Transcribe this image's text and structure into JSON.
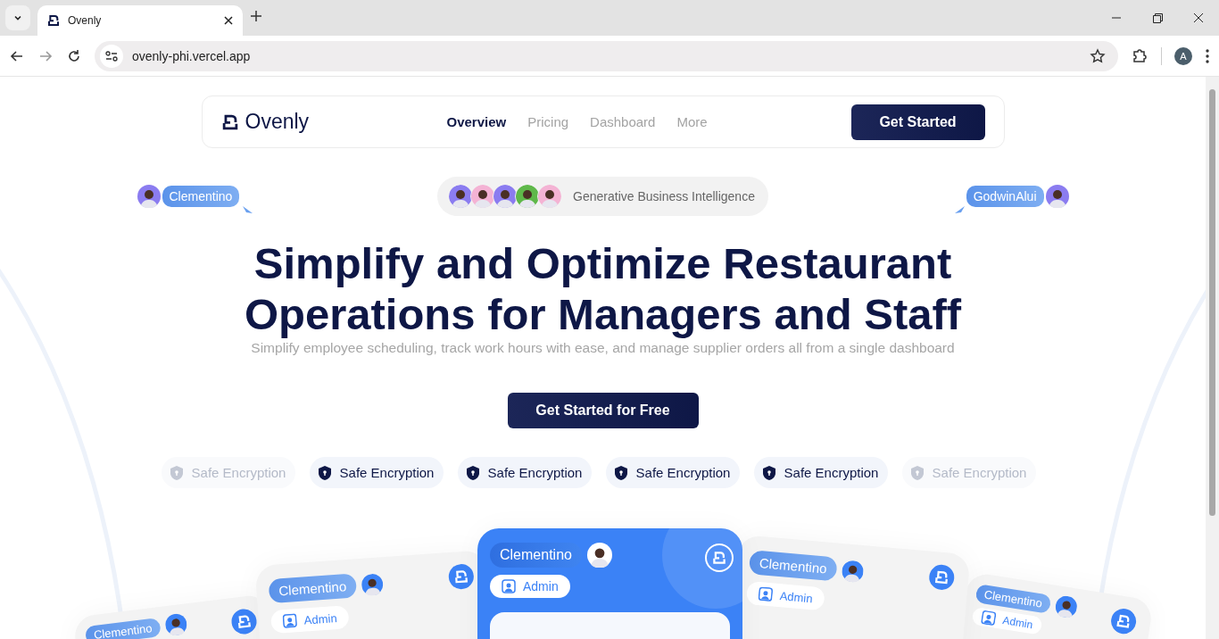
{
  "browser": {
    "tabs": [
      {
        "title": "Ovenly",
        "selected": true
      }
    ],
    "url": "ovenly-phi.vercel.app",
    "profile_initial": "A"
  },
  "nav": {
    "brand": "Ovenly",
    "links": [
      {
        "label": "Overview",
        "selected": true
      },
      {
        "label": "Pricing",
        "selected": false
      },
      {
        "label": "Dashboard",
        "selected": false
      },
      {
        "label": "More",
        "selected": false
      }
    ],
    "cta": "Get Started"
  },
  "hero": {
    "left_tag": {
      "name": "Clementino"
    },
    "right_tag": {
      "name": "GodwinAlui"
    },
    "badge": {
      "avatars": [
        {
          "color": "#8b7cf0"
        },
        {
          "color": "#f4b3d4"
        },
        {
          "color": "#8b7cf0"
        },
        {
          "color": "#5fb84a"
        },
        {
          "color": "#f4b3d4"
        }
      ],
      "text": "Generative Business Intelligence"
    },
    "title": "Simplify and Optimize Restaurant Operations for Managers and Staff",
    "subtitle": "Simplify employee scheduling, track work hours with ease, and manage supplier orders all from a single dashboard",
    "cta": "Get Started for Free"
  },
  "features": [
    {
      "label": "Safe Encryption",
      "faded": true
    },
    {
      "label": "Safe Encryption",
      "faded": false
    },
    {
      "label": "Safe Encryption",
      "faded": false
    },
    {
      "label": "Safe Encryption",
      "faded": false
    },
    {
      "label": "Safe Encryption",
      "faded": false
    },
    {
      "label": "Safe Encryption",
      "faded": true
    }
  ],
  "cards": [
    {
      "name": "Clementino",
      "highlighted": false
    },
    {
      "name": "Clementino",
      "role": "Admin",
      "highlighted": false
    },
    {
      "name": "Clementino",
      "role": "Admin",
      "highlighted": true
    },
    {
      "name": "Clementino",
      "role": "Admin",
      "highlighted": false
    },
    {
      "name": "Clementino",
      "role": "Admin",
      "highlighted": false
    }
  ]
}
